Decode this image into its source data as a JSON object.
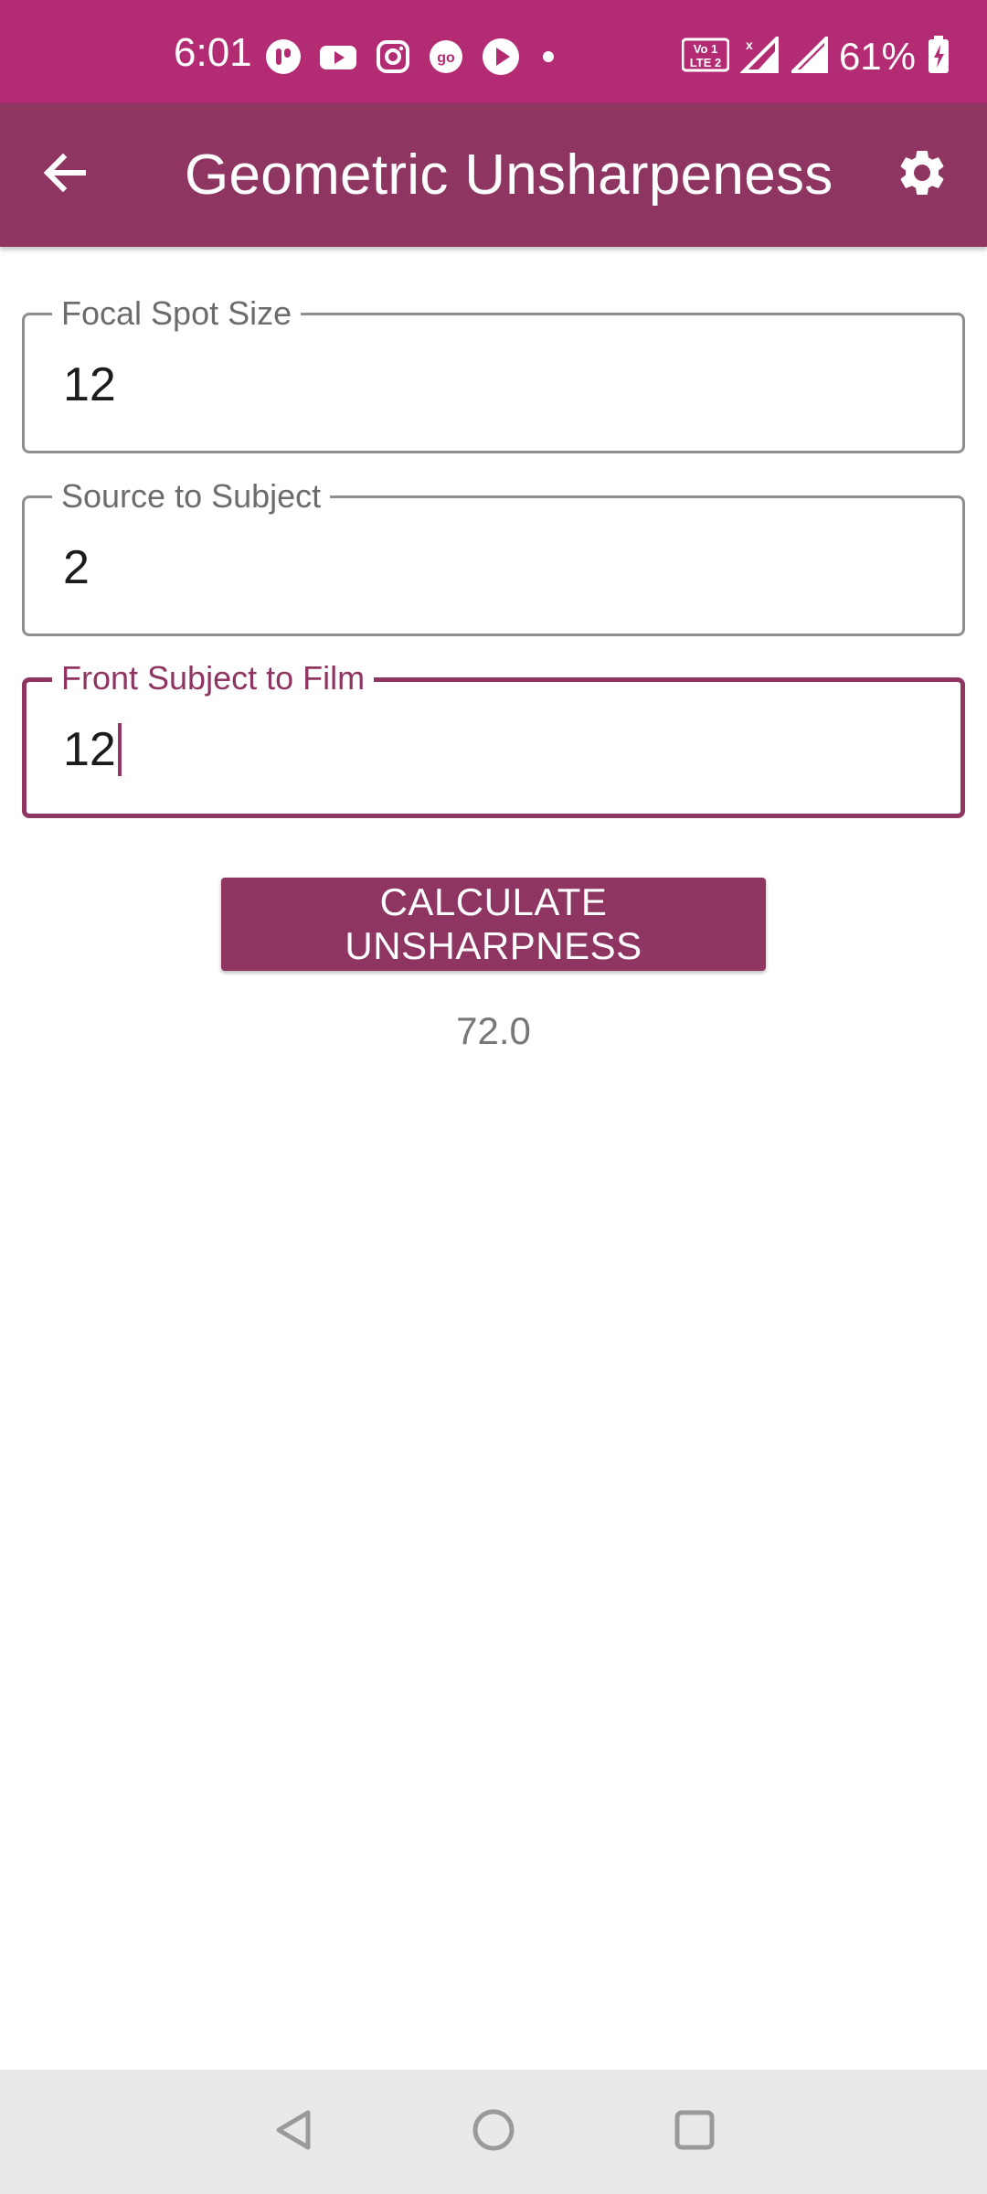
{
  "status_bar": {
    "time": "6:01",
    "battery": "61%",
    "color": "#b32b73",
    "left_icons": [
      "tiktok-icon",
      "youtube-icon",
      "instagram-icon",
      "go-icon",
      "play-icon",
      "dot-icon"
    ],
    "right_icons": [
      "volte-icon",
      "signal-icon",
      "signal-icon",
      "battery-charging-icon"
    ]
  },
  "app_bar": {
    "title": "Geometric Unsharpeness",
    "color": "#8e3562",
    "back_icon": "arrow-back-icon",
    "settings_icon": "gear-icon"
  },
  "fields": [
    {
      "label": "Focal Spot Size",
      "value": "12",
      "focused": false
    },
    {
      "label": "Source to Subject",
      "value": "2",
      "focused": false
    },
    {
      "label": "Front Subject to Film",
      "value": "12",
      "focused": true
    }
  ],
  "calculate_button": {
    "label": "CALCULATE UNSHARPNESS"
  },
  "result": "72.0",
  "nav_bar": {
    "icons": [
      "back-triangle-icon",
      "home-circle-icon",
      "recents-square-icon"
    ]
  }
}
